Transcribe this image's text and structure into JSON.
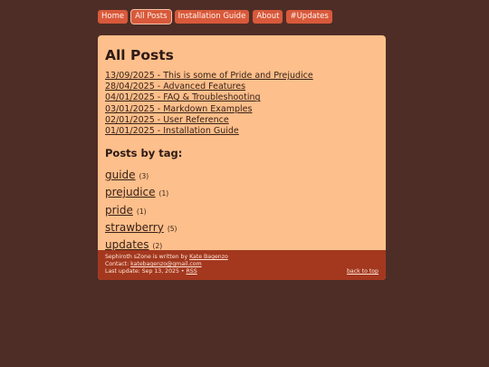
{
  "nav": {
    "items": [
      {
        "label": "Home"
      },
      {
        "label": "All Posts"
      },
      {
        "label": "Installation Guide"
      },
      {
        "label": "About"
      },
      {
        "label": "#Updates"
      }
    ]
  },
  "main": {
    "title": "All Posts",
    "posts": [
      {
        "label": "13/09/2025 - This is some of Pride and Prejudice"
      },
      {
        "label": "28/04/2025 - Advanced Features"
      },
      {
        "label": "04/01/2025 - FAQ & Troubleshooting"
      },
      {
        "label": "03/01/2025 - Markdown Examples"
      },
      {
        "label": "02/01/2025 - User Reference"
      },
      {
        "label": "01/01/2025 - Installation Guide"
      }
    ],
    "tags_heading": "Posts by tag:",
    "tags": [
      {
        "name": "guide",
        "count": "(3)"
      },
      {
        "name": "prejudice",
        "count": "(1)"
      },
      {
        "name": "pride",
        "count": "(1)"
      },
      {
        "name": "strawberry",
        "count": "(5)"
      },
      {
        "name": "updates",
        "count": "(2)"
      }
    ]
  },
  "footer": {
    "written_by_text": "Sephiroth sZone is written by",
    "author": "Kate Bagenzo",
    "contact_text": "Contact:",
    "email": "katebagenzo@gmail.com",
    "last_update": "Last update: Sep 13, 2025 •",
    "rss": "RSS",
    "back_to_top": "back to top"
  },
  "colors": {
    "background": "#4e2d26",
    "nav_button": "#d8593b",
    "card": "#fdbf8b",
    "footer": "#a3381f"
  }
}
